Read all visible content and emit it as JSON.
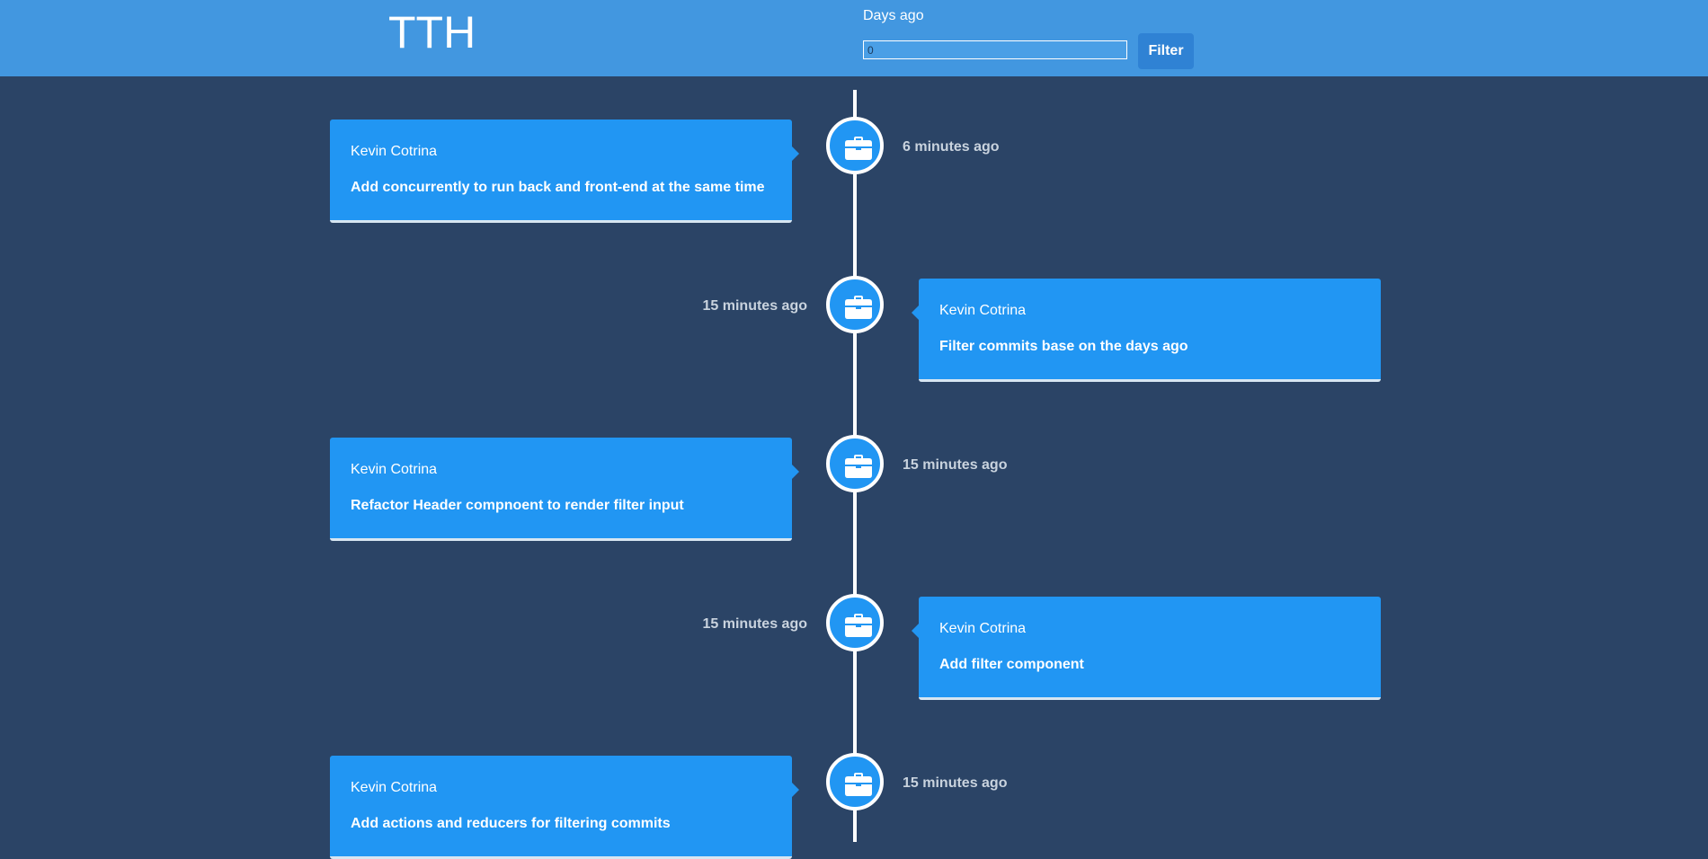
{
  "header": {
    "logo": "TTH",
    "filter_label": "Days ago",
    "filter_value": "0",
    "filter_button": "Filter"
  },
  "colors": {
    "header_bg": "#4297e0",
    "page_bg": "#2b4466",
    "card_bg": "#2196f3",
    "timeline": "#ffffff"
  },
  "commits": [
    {
      "author": "Kevin Cotrina",
      "message": "Add concurrently to run back and front-end at the same time",
      "time": "6 minutes ago",
      "side": "left",
      "icon": "briefcase-icon"
    },
    {
      "author": "Kevin Cotrina",
      "message": "Filter commits base on the days ago",
      "time": "15 minutes ago",
      "side": "right",
      "icon": "briefcase-icon"
    },
    {
      "author": "Kevin Cotrina",
      "message": "Refactor Header compnoent to render filter input",
      "time": "15 minutes ago",
      "side": "left",
      "icon": "briefcase-icon"
    },
    {
      "author": "Kevin Cotrina",
      "message": "Add filter component",
      "time": "15 minutes ago",
      "side": "right",
      "icon": "briefcase-icon"
    },
    {
      "author": "Kevin Cotrina",
      "message": "Add actions and reducers for filtering commits",
      "time": "15 minutes ago",
      "side": "left",
      "icon": "briefcase-icon"
    }
  ]
}
